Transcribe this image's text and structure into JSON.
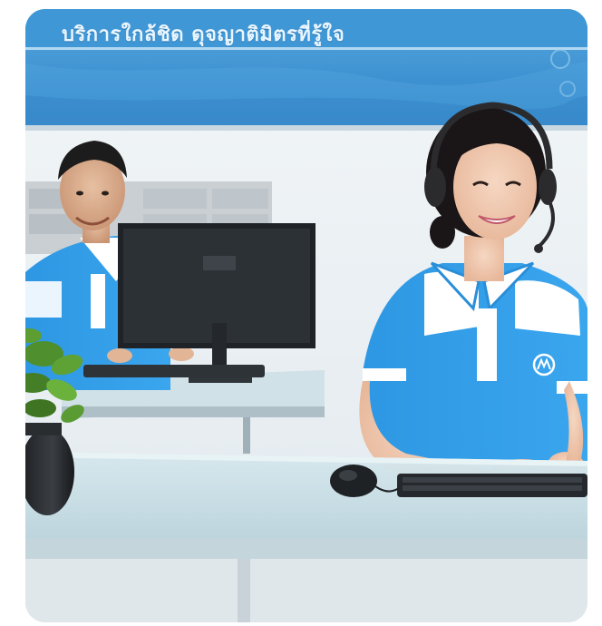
{
  "banner": {
    "text": "บริการใกล้ชิด ดุจญาติมิตรที่รู้ใจ"
  },
  "colors": {
    "banner_blue": "#3a8fd0",
    "shirt_blue": "#2f9ae6",
    "wall": "#eaf0f4",
    "desk_glass": "#cfe3ea"
  },
  "scene": {
    "people": [
      "agent-woman-headset",
      "agent-man-background"
    ],
    "objects": [
      "monitor",
      "keyboard",
      "mouse",
      "potted-plant",
      "file-cabinet"
    ]
  }
}
